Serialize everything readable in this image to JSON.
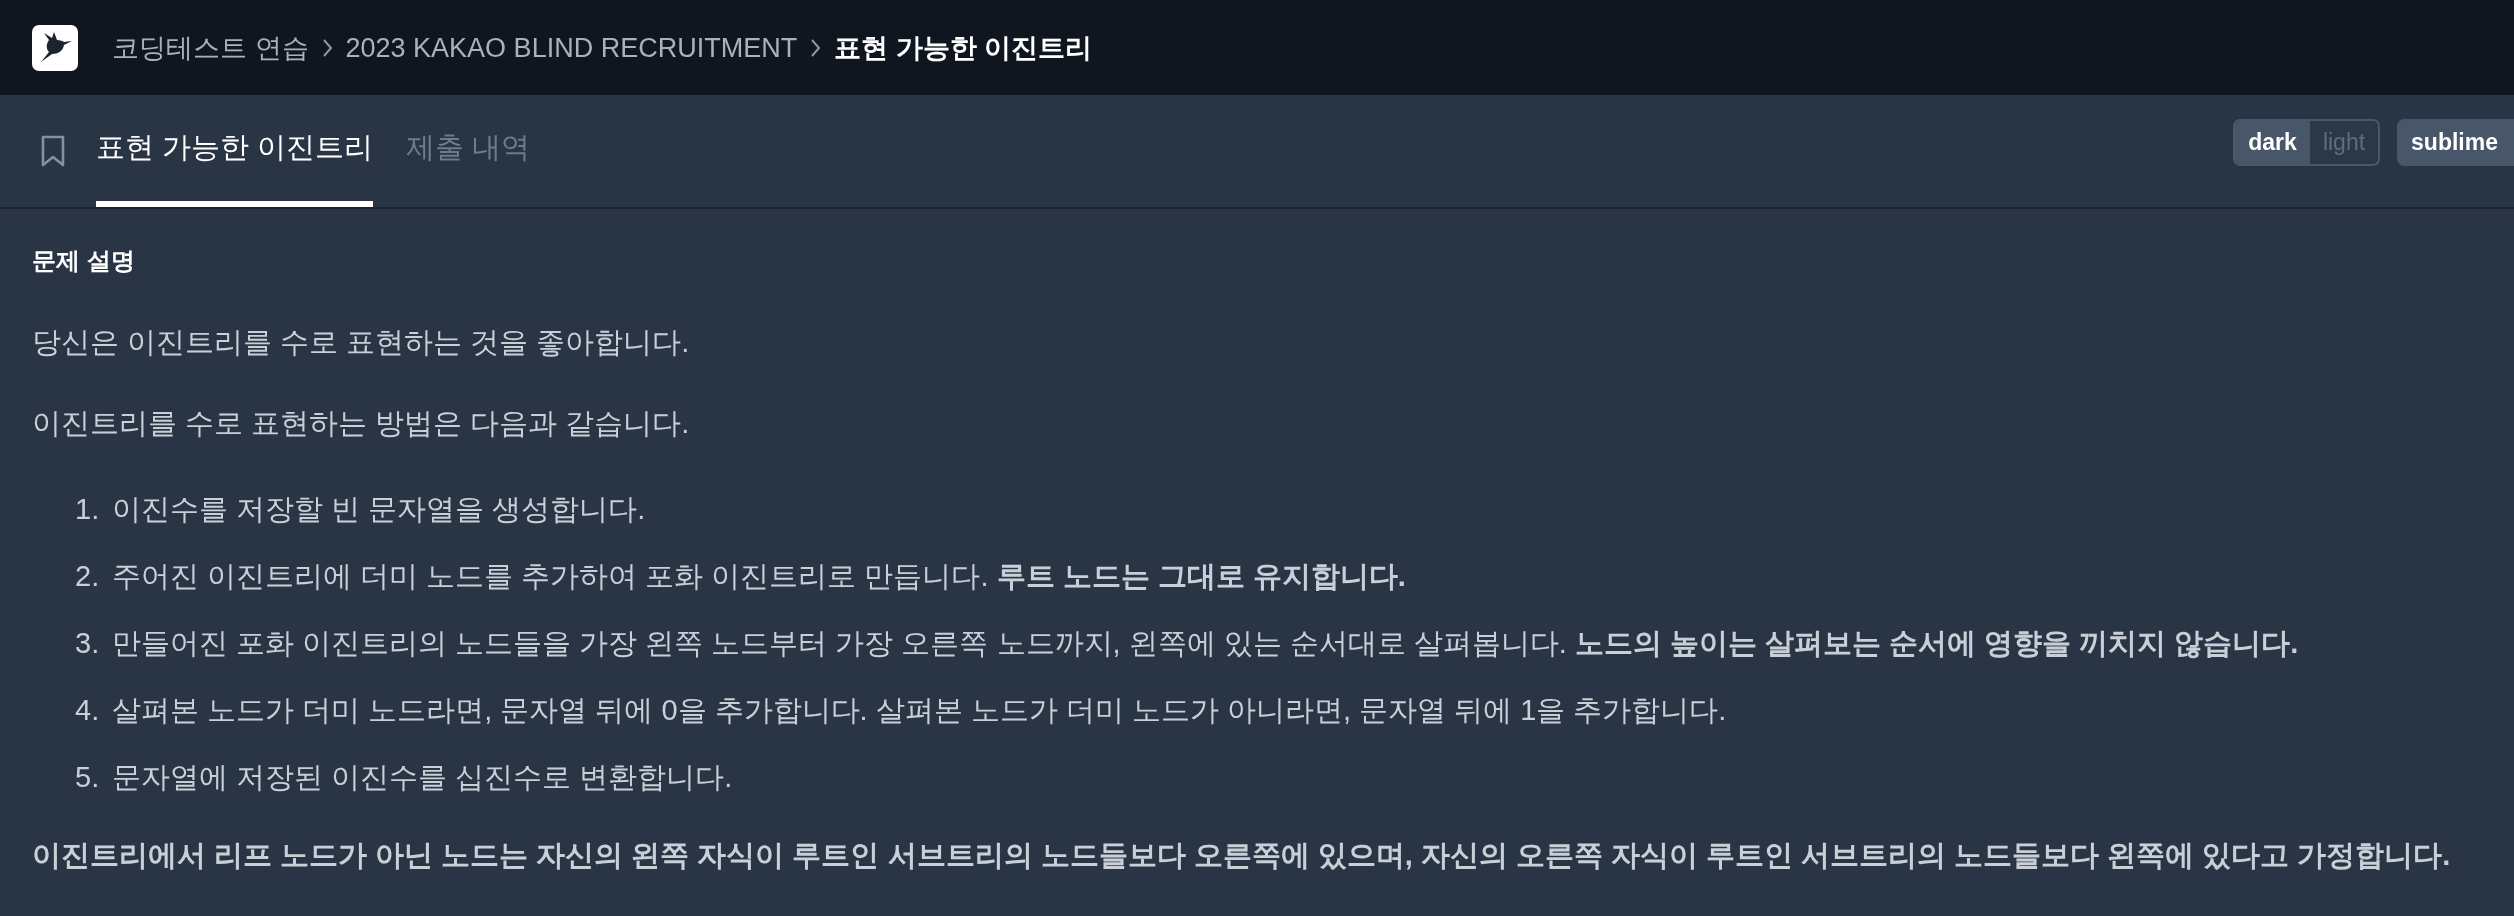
{
  "top_bar": {
    "breadcrumb": [
      {
        "label": "코딩테스트 연습",
        "current": false
      },
      {
        "label": "2023 KAKAO BLIND RECRUITMENT",
        "current": false
      },
      {
        "label": "표현 가능한 이진트리",
        "current": true
      }
    ]
  },
  "tabs": [
    {
      "label": "표현 가능한 이진트리",
      "selected": true
    },
    {
      "label": "제출 내역",
      "selected": false
    }
  ],
  "theme_toggle": [
    {
      "label": "dark",
      "selected": true
    },
    {
      "label": "light",
      "selected": false
    }
  ],
  "editor_theme": {
    "label": "sublime"
  },
  "description": {
    "heading": "문제 설명",
    "blocks": [
      {
        "kind": "paragraph",
        "bold": false,
        "text": "당신은 이진트리를 수로 표현하는 것을 좋아합니다."
      },
      {
        "kind": "paragraph",
        "bold": false,
        "text": "이진트리를 수로 표현하는 방법은 다음과 같습니다."
      },
      {
        "kind": "ordered_list",
        "items": [
          {
            "number": "1.",
            "text": "이진수를 저장할 빈 문자열을 생성합니다."
          },
          {
            "number": "2.",
            "text": "주어진 이진트리에 더미 노드를 추가하여 포화 이진트리로 만듭니다. **루트 노드는 그대로 유지합니다.**"
          },
          {
            "number": "3.",
            "text": "만들어진 포화 이진트리의 노드들을 가장 왼쪽 노드부터 가장 오른쪽 노드까지, 왼쪽에 있는 순서대로 살펴봅니다. **노드의 높이는 살펴보는 순서에 영향을 끼치지 않습니다.**"
          },
          {
            "number": "4.",
            "text": "살펴본 노드가 더미 노드라면, 문자열 뒤에 0을 추가합니다. 살펴본 노드가 더미 노드가 아니라면, 문자열 뒤에 1을 추가합니다."
          },
          {
            "number": "5.",
            "text": "문자열에 저장된 이진수를 십진수로 변환합니다."
          }
        ]
      },
      {
        "kind": "paragraph",
        "bold": true,
        "text": "이진트리에서 리프 노드가 아닌 노드는 자신의 왼쪽 자식이 루트인 서브트리의 노드들보다 오른쪽에 있으며, 자신의 오른쪽 자식이 루트인 서브트리의 노드들보다 왼쪽에 있다고 가정합니다."
      }
    ]
  }
}
